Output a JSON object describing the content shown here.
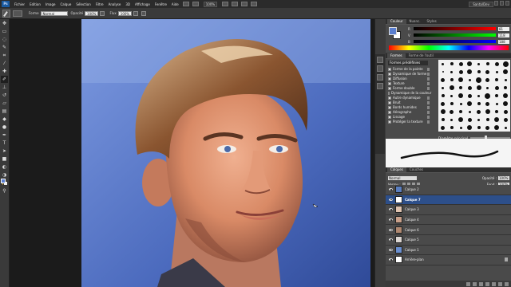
{
  "app": {
    "logo": "Ps",
    "menus": [
      "Fichier",
      "Edition",
      "Image",
      "Calque",
      "Sélection",
      "Filtre",
      "Analyse",
      "3D",
      "Affichage",
      "Fenêtre",
      "Aide"
    ],
    "zoom": "100%",
    "workspace": "Santa/Dev"
  },
  "options": {
    "mode_label": "Forme",
    "mode_value": "Normal",
    "opacity_label": "Opacité",
    "opacity_value": "100%",
    "flow_label": "Flux",
    "flow_value": "100%"
  },
  "tools": [
    {
      "name": "move-tool",
      "glyph": "✥"
    },
    {
      "name": "marquee-tool",
      "glyph": "▭"
    },
    {
      "name": "lasso-tool",
      "glyph": "◌"
    },
    {
      "name": "quick-select-tool",
      "glyph": "✎"
    },
    {
      "name": "crop-tool",
      "glyph": "⌗"
    },
    {
      "name": "eyedropper-tool",
      "glyph": "⁄"
    },
    {
      "name": "healing-tool",
      "glyph": "✚"
    },
    {
      "name": "brush-tool",
      "glyph": "✐"
    },
    {
      "name": "stamp-tool",
      "glyph": "⊥"
    },
    {
      "name": "history-brush-tool",
      "glyph": "↺"
    },
    {
      "name": "eraser-tool",
      "glyph": "▱"
    },
    {
      "name": "gradient-tool",
      "glyph": "▤"
    },
    {
      "name": "blur-tool",
      "glyph": "◆"
    },
    {
      "name": "dodge-tool",
      "glyph": "●"
    },
    {
      "name": "pen-tool",
      "glyph": "✒"
    },
    {
      "name": "type-tool",
      "glyph": "T"
    },
    {
      "name": "path-select-tool",
      "glyph": "➤"
    },
    {
      "name": "shape-tool",
      "glyph": "■"
    },
    {
      "name": "3d-rotate-tool",
      "glyph": "◐"
    },
    {
      "name": "3d-orbit-tool",
      "glyph": "◑"
    },
    {
      "name": "hand-tool",
      "glyph": "✋"
    },
    {
      "name": "zoom-tool",
      "glyph": "⚲"
    }
  ],
  "color_panel": {
    "tabs": [
      "Couleur",
      "Nuanc.",
      "Styles"
    ],
    "channels": [
      {
        "label": "R",
        "value": "81"
      },
      {
        "label": "V",
        "value": "118"
      },
      {
        "label": "B",
        "value": "188"
      }
    ]
  },
  "brush_panel": {
    "tabs": [
      "Formes",
      "Forme de l'outil"
    ],
    "preset_button": "Formes prédéfinies",
    "options": [
      "Forme de la pointe",
      "Dynamique de forme",
      "Diffusion",
      "Texture",
      "Forme double",
      "Dynamique de la couleur",
      "Autre dynamique",
      "Bruit",
      "Bords humides",
      "Aérographe",
      "Lissage",
      "Protéger la texture"
    ],
    "spacing_label": "Diamètre principal",
    "spacing_value": 0.35
  },
  "layers_panel": {
    "tabs": [
      "Calques",
      "Couches"
    ],
    "blend_mode": "Normal",
    "opacity_label": "Opacité :",
    "opacity_value": "100%",
    "lock_label": "Verrou :",
    "fill_label": "Fond :",
    "fill_value": "100%",
    "layers": [
      {
        "name": "Calque 2",
        "thumb": "#5b7fc0",
        "selected": false
      },
      {
        "name": "Calque 7",
        "thumb": "#ffffff",
        "selected": true
      },
      {
        "name": "Calque 3",
        "thumb": "#e0c4b0",
        "selected": false
      },
      {
        "name": "Calque 4",
        "thumb": "#c9a08a",
        "selected": false
      },
      {
        "name": "Calque 6",
        "thumb": "#b08870",
        "selected": false
      },
      {
        "name": "Calque 5",
        "thumb": "#dcd6d2",
        "selected": false
      },
      {
        "name": "Calque 1",
        "thumb": "#6a8fd0",
        "selected": false
      },
      {
        "name": "Arrière-plan",
        "thumb": "#ffffff",
        "selected": false
      }
    ]
  },
  "colors": {
    "foreground": "#5a7ecf",
    "background": "#ffffff",
    "selection": "#2d4f8a"
  }
}
